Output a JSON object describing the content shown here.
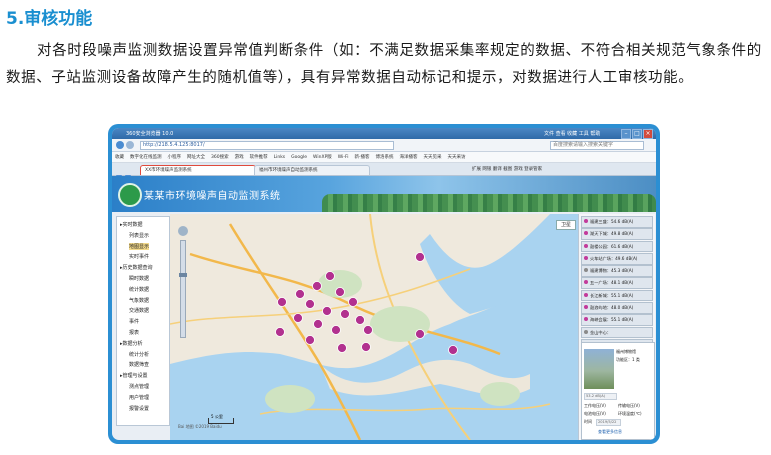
{
  "doc": {
    "heading": "5.审核功能",
    "paragraph": "对各时段噪声监测数据设置异常值判断条件（如：不满足数据采集率规定的数据、不符合相关规范气象条件的数据、子站监测设备故障产生的随机值等），具有异常数据自动标记和提示，对数据进行人工审核功能。"
  },
  "browser": {
    "window_title": "360安全浏览器 10.0",
    "menu": "文件  查看  收藏  工具  帮助",
    "url": "http://218.5.4.125:8017/",
    "search_placeholder": "百度搜索请输入搜索关键字",
    "bookmarks": [
      "收藏",
      "数字化在线监测",
      "小程序",
      "网址大全",
      "360搜索",
      "游戏",
      "软件推荐",
      "Links",
      "Google",
      "WinXP版",
      "Wi-Fi",
      "新·播客",
      "博洛系统",
      "海洋播客",
      "天天见采",
      "天天采访"
    ],
    "tabs": {
      "active": "XX市环境噪声监测系统",
      "other": "福州市环境噪声自动监测系统"
    },
    "right_tools": "扩展  网银  翻译  截图  游戏  登录管家"
  },
  "app": {
    "title": "某某市环境噪声自动监测系统",
    "sidebar": [
      {
        "label": "▸实时数据",
        "indent": 0,
        "selected": false
      },
      {
        "label": "列表显示",
        "indent": 1,
        "selected": false
      },
      {
        "label": "地图显示",
        "indent": 1,
        "selected": true
      },
      {
        "label": "实时事件",
        "indent": 1,
        "selected": false
      },
      {
        "label": "▸历史数据查询",
        "indent": 0,
        "selected": false
      },
      {
        "label": "瞬时数据",
        "indent": 1,
        "selected": false
      },
      {
        "label": "统计数据",
        "indent": 1,
        "selected": false
      },
      {
        "label": "气象数据",
        "indent": 1,
        "selected": false
      },
      {
        "label": "交通数据",
        "indent": 1,
        "selected": false
      },
      {
        "label": "事件",
        "indent": 1,
        "selected": false
      },
      {
        "label": "报表",
        "indent": 1,
        "selected": false
      },
      {
        "label": "▸数据分析",
        "indent": 0,
        "selected": false
      },
      {
        "label": "统计分析",
        "indent": 1,
        "selected": false
      },
      {
        "label": "数据筛查",
        "indent": 1,
        "selected": false
      },
      {
        "label": "▸管理与设置",
        "indent": 0,
        "selected": false
      },
      {
        "label": "测点管理",
        "indent": 1,
        "selected": false
      },
      {
        "label": "用户管理",
        "indent": 1,
        "selected": false
      },
      {
        "label": "报警设置",
        "indent": 1,
        "selected": false
      }
    ],
    "map_type_button": "卫星",
    "scale_label": "5 公里",
    "copyright": "Bai 地图 ©2019 Baidu",
    "stations": [
      {
        "label": "福建三盛：54.6 dB(A)",
        "alert": true
      },
      {
        "label": "湖天下城：49.8 dB(A)",
        "alert": true
      },
      {
        "label": "鼓楼公园：61.6 dB(A)",
        "alert": true
      },
      {
        "label": "火车站广场：49.6 dB(A)",
        "alert": true
      },
      {
        "label": "福建博物：45.3 dB(A)",
        "alert": false
      },
      {
        "label": "五一广场：48.1 dB(A)",
        "alert": true
      },
      {
        "label": "长江新城：55.1 dB(A)",
        "alert": true
      },
      {
        "label": "鼓浪屿地：48.0 dB(A)",
        "alert": true
      },
      {
        "label": "海峡会展：55.1 dB(A)",
        "alert": true
      },
      {
        "label": "金山中心：",
        "alert": false
      },
      {
        "label": "福州博物馆：53.2 dB(A)",
        "alert": true
      }
    ],
    "detail": {
      "name": "福州博物馆",
      "value_label": "功能区：1 类",
      "value_box": "53.2 dB(A)",
      "rows": [
        "工作电压(V)",
        "传输电压(V)",
        "电池电压(V)",
        "环境温度(℃)",
        "时间"
      ],
      "date": "2019/5/22",
      "footer": "查看更多信息"
    }
  }
}
